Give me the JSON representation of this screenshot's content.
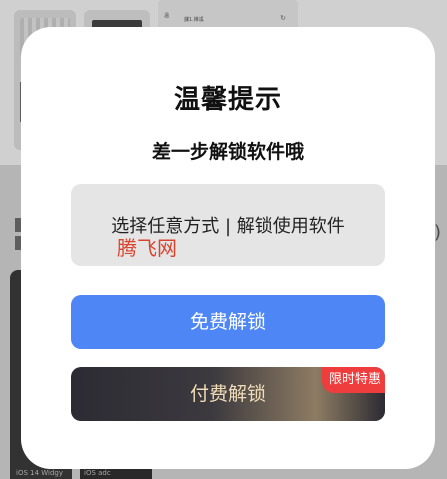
{
  "background": {
    "card_text_1": "温",
    "card_text_2": "課1.推溪",
    "caption_1": "iOS 14 Widgy",
    "caption_2": "iOS adc",
    "paren": ")"
  },
  "dialog": {
    "title": "温馨提示",
    "subtitle": "差一步解锁软件哦",
    "message": "选择任意方式 | 解锁使用软件",
    "watermark": "腾飞网",
    "free_button": "免费解锁",
    "paid_button": "付费解锁",
    "paid_badge": "限时特惠"
  },
  "colors": {
    "free_button": "#4e87f5",
    "badge": "#ef3d3d",
    "paid_text": "#f0dcb6"
  }
}
